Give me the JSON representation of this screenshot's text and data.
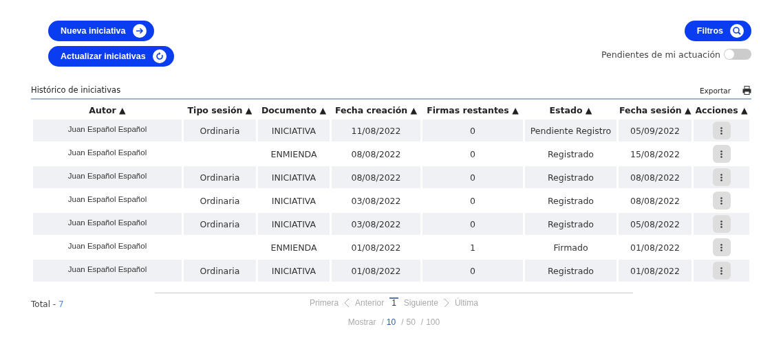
{
  "actions": [
    {
      "label": "Nueva iniciativa",
      "kind": "arrow"
    },
    {
      "label": "Actualizar iniciativas",
      "kind": "refresh"
    }
  ],
  "filters": {
    "label": "Filtros"
  },
  "pending_toggle": {
    "label": "Pendientes de mi actuación",
    "on": false
  },
  "section_title": "Histórico de iniciativas",
  "export": {
    "label": "Exportar"
  },
  "table": {
    "columns": [
      "Autor ▲",
      "Tipo sesión ▲",
      "Documento ▲",
      "Fecha creación ▲",
      "Firmas restantes ▲",
      "Estado ▲",
      "Fecha sesión ▲",
      "Acciones ▲"
    ],
    "rows": [
      {
        "autor": "Juan Español Español",
        "tipo": "Ordinaria",
        "documento": "INICIATIVA",
        "fecha_creacion": "11/08/2022",
        "firmas": "0",
        "estado": "Pendiente Registro",
        "fecha_sesion": "05/09/2022"
      },
      {
        "autor": "Juan Español Español",
        "tipo": "",
        "documento": "ENMIENDA",
        "fecha_creacion": "08/08/2022",
        "firmas": "0",
        "estado": "Registrado",
        "fecha_sesion": "15/08/2022"
      },
      {
        "autor": "Juan Español Español",
        "tipo": "Ordinaria",
        "documento": "INICIATIVA",
        "fecha_creacion": "08/08/2022",
        "firmas": "0",
        "estado": "Registrado",
        "fecha_sesion": "08/08/2022"
      },
      {
        "autor": "Juan Español Español",
        "tipo": "Ordinaria",
        "documento": "INICIATIVA",
        "fecha_creacion": "03/08/2022",
        "firmas": "0",
        "estado": "Registrado",
        "fecha_sesion": "08/08/2022"
      },
      {
        "autor": "Juan Español Español",
        "tipo": "Ordinaria",
        "documento": "INICIATIVA",
        "fecha_creacion": "03/08/2022",
        "firmas": "0",
        "estado": "Registrado",
        "fecha_sesion": "05/08/2022"
      },
      {
        "autor": "Juan Español Español",
        "tipo": "",
        "documento": "ENMIENDA",
        "fecha_creacion": "01/08/2022",
        "firmas": "1",
        "estado": "Firmado",
        "fecha_sesion": "01/08/2022"
      },
      {
        "autor": "Juan Español Español",
        "tipo": "Ordinaria",
        "documento": "INICIATIVA",
        "fecha_creacion": "01/08/2022",
        "firmas": "0",
        "estado": "Registrado",
        "fecha_sesion": "01/08/2022"
      }
    ]
  },
  "total": {
    "label": "Total -",
    "value": "7"
  },
  "pagination": {
    "first": "Primera",
    "prev": "Anterior",
    "pages": [
      {
        "label": "1",
        "selected": true
      }
    ],
    "next": "Siguiente",
    "last": "Última"
  },
  "page_size": {
    "label": "Mostrar",
    "options": [
      {
        "separator": "/",
        "label": "10",
        "selected": true
      },
      {
        "separator": "/",
        "label": "50",
        "selected": false
      },
      {
        "separator": "/",
        "label": "100",
        "selected": false
      }
    ]
  }
}
